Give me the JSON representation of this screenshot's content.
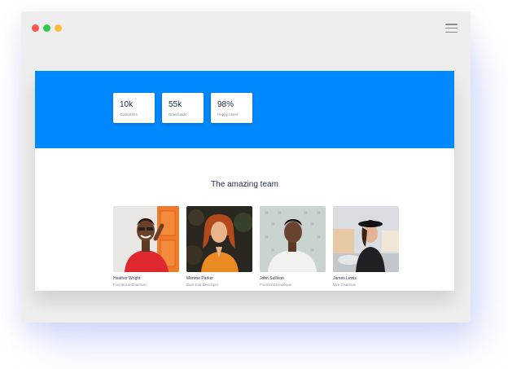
{
  "window": {
    "controls": [
      {
        "name": "close",
        "color": "#fc5652"
      },
      {
        "name": "minimize",
        "color": "#fdbc40"
      },
      {
        "name": "maximize",
        "color": "#34c84a"
      }
    ],
    "menu_icon": "hamburger-menu-icon"
  },
  "hero": {
    "background": "#0088ff",
    "stats": [
      {
        "value": "10k",
        "label": "Customers"
      },
      {
        "value": "55k",
        "label": "Downloads"
      },
      {
        "value": "98%",
        "label": "Happy users"
      }
    ]
  },
  "team": {
    "title": "The amazing team",
    "members": [
      {
        "name": "Heather Wright",
        "role": "Founded & Chairman"
      },
      {
        "name": "Monroe Parker",
        "role": "Back End Developer"
      },
      {
        "name": "John Sullivan",
        "role": "Front End Developer"
      },
      {
        "name": "James Lewis",
        "role": "Vice Chairman"
      }
    ]
  }
}
